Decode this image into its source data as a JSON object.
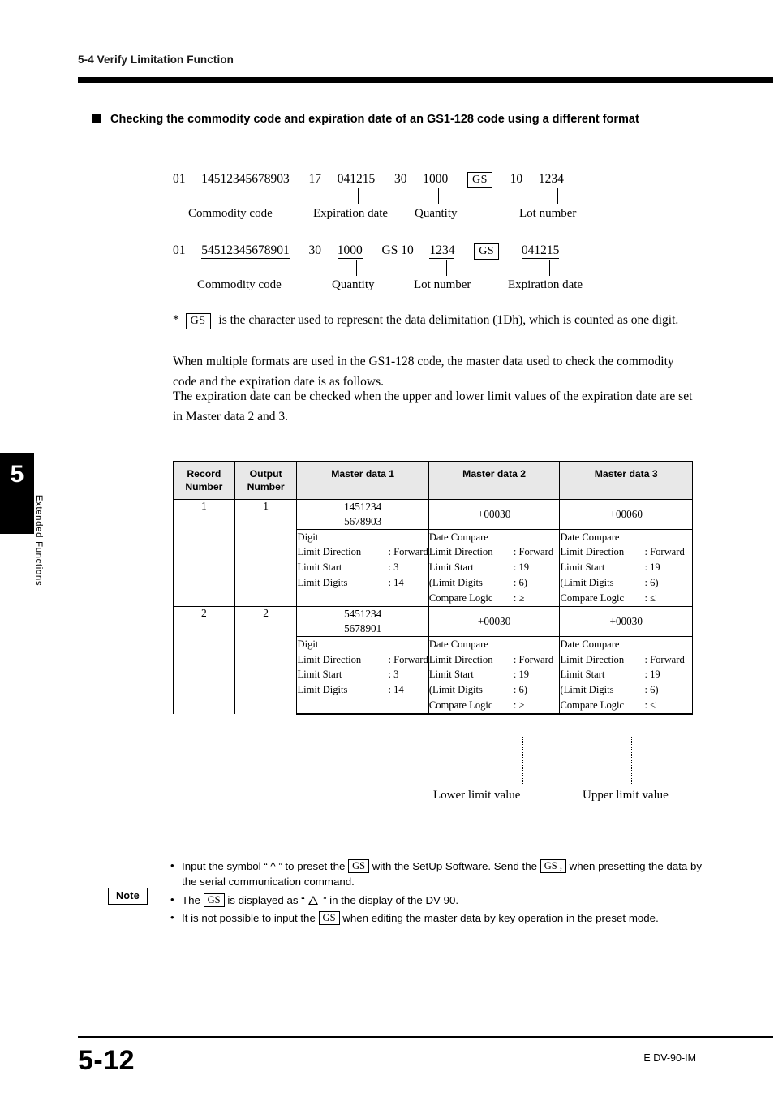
{
  "header": {
    "running_head": "5-4  Verify Limitation Function"
  },
  "side_tab": {
    "chapter_number": "5",
    "chapter_label": "Extended Functions"
  },
  "section": {
    "title": "Checking the commodity code and expiration date of an GS1-128 code using a different format"
  },
  "code_diagram_1": {
    "ai_01": "01",
    "commodity_value": "14512345678903",
    "ai_17": "17",
    "expiration_value": "041215",
    "ai_30": "30",
    "quantity_value": "1000",
    "gs": "GS",
    "ai_10": "10",
    "lot_value": "1234",
    "label_commodity": "Commodity code",
    "label_expiration": "Expiration date",
    "label_quantity": "Quantity",
    "label_lot": "Lot number"
  },
  "code_diagram_2": {
    "ai_01": "01",
    "commodity_value": "54512345678901",
    "ai_30": "30",
    "quantity_value": "1000",
    "gs_ai_10": "GS 10",
    "lot_value": "1234",
    "gs": "GS",
    "expiration_value": "041215",
    "label_commodity": "Commodity code",
    "label_quantity": "Quantity",
    "label_lot": "Lot number",
    "label_expiration": "Expiration date"
  },
  "footnote": {
    "star": "*",
    "gs": "GS",
    "text": "is the character used to represent the data delimitation (1Dh), which is counted as one digit."
  },
  "body": {
    "paragraph_1": "When multiple formats are used in the GS1-128 code, the master data used to check the commodity code and the expiration date is as follows.",
    "paragraph_2": "The expiration date can be checked when the upper and lower limit values of the expiration date are set in Master data 2 and 3."
  },
  "table": {
    "headers": {
      "record_number": "Record\nNumber",
      "record_number_l1": "Record",
      "record_number_l2": "Number",
      "output_number_l1": "Output",
      "output_number_l2": "Number",
      "master_data_1": "Master data 1",
      "master_data_2": "Master data 2",
      "master_data_3": "Master data 3"
    },
    "rows": [
      {
        "record_number": "1",
        "output_number": "1",
        "md1_value_l1": "1451234",
        "md1_value_l2": "5678903",
        "md2_value": "+00030",
        "md3_value": "+00060",
        "md1_detail": {
          "line1": "Digit",
          "line2_k": "Limit Direction",
          "line2_v": ": Forward",
          "line3_k": "Limit Start",
          "line3_v": ": 3",
          "line4_k": "Limit Digits",
          "line4_v": ": 14"
        },
        "md2_detail": {
          "line1": "Date Compare",
          "line2_k": "Limit Direction",
          "line2_v": ": Forward",
          "line3_k": "Limit Start",
          "line3_v": ": 19",
          "line4_k": "(Limit Digits",
          "line4_v": ": 6)",
          "line5_k": "Compare Logic",
          "line5_v": ": ≥"
        },
        "md3_detail": {
          "line1": "Date Compare",
          "line2_k": "Limit Direction",
          "line2_v": ": Forward",
          "line3_k": "Limit Start",
          "line3_v": ": 19",
          "line4_k": "(Limit Digits",
          "line4_v": ": 6)",
          "line5_k": "Compare Logic",
          "line5_v": ": ≤"
        }
      },
      {
        "record_number": "2",
        "output_number": "2",
        "md1_value_l1": "5451234",
        "md1_value_l2": "5678901",
        "md2_value": "+00030",
        "md3_value": "+00030",
        "md1_detail": {
          "line1": "Digit",
          "line2_k": "Limit Direction",
          "line2_v": ": Forward",
          "line3_k": "Limit Start",
          "line3_v": ": 3",
          "line4_k": "Limit Digits",
          "line4_v": ": 14"
        },
        "md2_detail": {
          "line1": "Date Compare",
          "line2_k": "Limit Direction",
          "line2_v": ": Forward",
          "line3_k": "Limit Start",
          "line3_v": ": 19",
          "line4_k": "(Limit Digits",
          "line4_v": ": 6)",
          "line5_k": "Compare Logic",
          "line5_v": ": ≥"
        },
        "md3_detail": {
          "line1": "Date Compare",
          "line2_k": "Limit Direction",
          "line2_v": ": Forward",
          "line3_k": "Limit Start",
          "line3_v": ": 19",
          "line4_k": "(Limit Digits",
          "line4_v": ": 6)",
          "line5_k": "Compare Logic",
          "line5_v": ": ≤"
        }
      }
    ],
    "callouts": {
      "lower": "Lower limit value",
      "upper": "Upper limit value"
    }
  },
  "notes": {
    "badge": "Note",
    "item1_a": "Input the symbol “ ^ ” to preset the",
    "item1_gs": "GS",
    "item1_b": "with the SetUp Software. Send the",
    "item1_gs2": "GS ,",
    "item1_c": "when presetting the data by the serial communication command.",
    "item2_a": "The",
    "item2_gs": "GS",
    "item2_b": "is displayed as “",
    "item2_c": "” in the display of the DV-90.",
    "item3_a": "It is not possible to input the",
    "item3_gs": "GS",
    "item3_b": "when editing the master data by key operation in the preset mode."
  },
  "footer": {
    "page_number": "5-12",
    "model": "E DV-90-IM"
  }
}
